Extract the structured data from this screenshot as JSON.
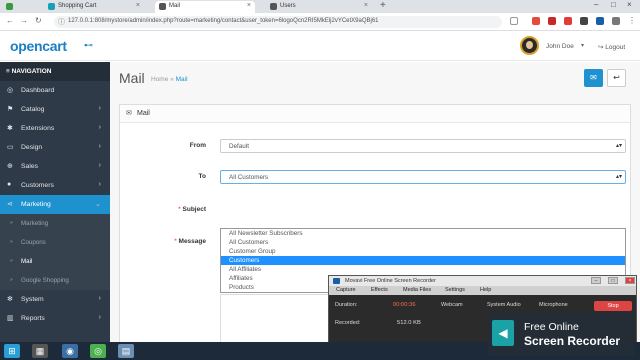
{
  "browser": {
    "tabs": [
      {
        "title": "",
        "color": "#3b9a3b"
      },
      {
        "title": "Shopping Cart",
        "color": "#17a0b5"
      },
      {
        "title": "Mail",
        "color": "#555555"
      },
      {
        "title": "Users",
        "color": "#555555"
      }
    ],
    "url": "127.0.0.1:808/mystore/admin/index.php?route=marketing/contact&user_token=6logoQcn2RI5MkElj2vYCetX9aQBj61"
  },
  "header": {
    "logo": "opencart",
    "user_name": "John Doe",
    "logout_label": "Logout"
  },
  "sidebar": {
    "heading": "NAVIGATION",
    "items": [
      {
        "label": "Dashboard",
        "icon": "dashboard-icon",
        "glyph": "◎"
      },
      {
        "label": "Catalog",
        "icon": "tag-icon",
        "glyph": "⚑"
      },
      {
        "label": "Extensions",
        "icon": "puzzle-icon",
        "glyph": "✱"
      },
      {
        "label": "Design",
        "icon": "monitor-icon",
        "glyph": "▭"
      },
      {
        "label": "Sales",
        "icon": "cart-icon",
        "glyph": "⊕"
      },
      {
        "label": "Customers",
        "icon": "user-icon",
        "glyph": "●"
      },
      {
        "label": "Marketing",
        "icon": "share-icon",
        "glyph": "⋖"
      },
      {
        "label": "Marketing"
      },
      {
        "label": "Coupons"
      },
      {
        "label": "Mail"
      },
      {
        "label": "Google Shopping"
      },
      {
        "label": "System",
        "icon": "cog-icon",
        "glyph": "✻"
      },
      {
        "label": "Reports",
        "icon": "bar-chart-icon",
        "glyph": "▥"
      }
    ]
  },
  "page": {
    "title": "Mail",
    "breadcrumb_home": "Home",
    "breadcrumb_sep": "»",
    "breadcrumb_current": "Mail"
  },
  "panel": {
    "heading": "Mail",
    "from_label": "From",
    "from_value": "Default",
    "to_label": "To",
    "to_value": "All Customers",
    "subject_label": "Subject",
    "message_label": "Message",
    "to_options": [
      "All Newsletter Subscribers",
      "All Customers",
      "Customer Group",
      "Customers",
      "All Affiliates",
      "Affiliates",
      "Products"
    ],
    "to_highlighted": "Customers"
  },
  "recorder": {
    "title": "Movavi Free Online Screen Recorder",
    "menu": [
      "Capture",
      "Effects",
      "Media Files",
      "Settings",
      "Help"
    ],
    "duration_label": "Duration:",
    "duration_value": "00:00:36",
    "recorded_label": "Recorded:",
    "recorded_value": "512.0 KB",
    "tabs": [
      "Webcam",
      "System Audio",
      "Microphone"
    ],
    "stop_label": "Stop",
    "brand_line1": "Free Online",
    "brand_line2": "Screen Recorder"
  },
  "colors": {
    "accent": "#1e91cf",
    "sidebar_bg": "#2e3a47",
    "option_highlight": "#1e90ff"
  }
}
